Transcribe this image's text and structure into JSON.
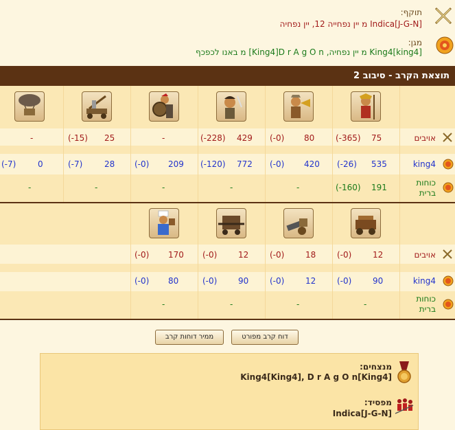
{
  "attacker": {
    "label": "תוקף:",
    "text": "Indica[J-G-N] מ יין נפחייה 12, יין נפחיה"
  },
  "defender": {
    "label": "מגן:",
    "text": "King4[king4] מ יין נפחיה, King4]D r A g O n] מ באנו לכפכף"
  },
  "battle_title": "תוצאת הקרב - סיבוב 2",
  "row_labels": {
    "enemies": "אויבים",
    "king4": "king4",
    "allies_line1": "כוחות",
    "allies_line2": "ברית"
  },
  "units_top": [
    {
      "icon": "spearman-unit-icon"
    },
    {
      "icon": "horn-unit-icon"
    },
    {
      "icon": "swordsman-unit-icon"
    },
    {
      "icon": "shield-unit-icon"
    },
    {
      "icon": "catapult-unit-icon"
    },
    {
      "icon": "airship-unit-icon"
    }
  ],
  "units_bottom": [
    {
      "icon": "cart-unit-icon"
    },
    {
      "icon": "cannon-unit-icon"
    },
    {
      "icon": "ram-unit-icon"
    },
    {
      "icon": "cook-unit-icon"
    }
  ],
  "top_enemies": [
    {
      "count": "75",
      "loss": "(-365)"
    },
    {
      "count": "80",
      "loss": "(-0)"
    },
    {
      "count": "429",
      "loss": "(-228)"
    },
    {
      "count": "",
      "loss": "-"
    },
    {
      "count": "25",
      "loss": "(-15)"
    },
    {
      "count": "",
      "loss": "-"
    }
  ],
  "top_king4": [
    {
      "count": "535",
      "loss": "(-26)"
    },
    {
      "count": "420",
      "loss": "(-0)"
    },
    {
      "count": "772",
      "loss": "(-120)"
    },
    {
      "count": "209",
      "loss": "(-0)"
    },
    {
      "count": "28",
      "loss": "(-7)"
    },
    {
      "count": "0",
      "loss": "(-7)"
    }
  ],
  "top_allies": [
    {
      "count": "191",
      "loss": "(-160)"
    },
    {
      "count": "",
      "loss": "-"
    },
    {
      "count": "",
      "loss": "-"
    },
    {
      "count": "",
      "loss": "-"
    },
    {
      "count": "",
      "loss": "-"
    },
    {
      "count": "",
      "loss": "-"
    }
  ],
  "bottom_enemies": [
    {
      "count": "12",
      "loss": "(-0)"
    },
    {
      "count": "18",
      "loss": "(-0)"
    },
    {
      "count": "12",
      "loss": "(-0)"
    },
    {
      "count": "170",
      "loss": "(-0)"
    }
  ],
  "bottom_king4": [
    {
      "count": "90",
      "loss": "(-0)"
    },
    {
      "count": "12",
      "loss": "(-0)"
    },
    {
      "count": "90",
      "loss": "(-0)"
    },
    {
      "count": "80",
      "loss": "(-0)"
    }
  ],
  "bottom_allies": [
    {
      "count": "",
      "loss": "-"
    },
    {
      "count": "",
      "loss": "-"
    },
    {
      "count": "",
      "loss": "-"
    },
    {
      "count": "",
      "loss": "-"
    }
  ],
  "buttons": {
    "detailed": "דוח קרב מפורט",
    "converter": "ממיר דוחות קרב"
  },
  "summary": {
    "winners_label": "מנצחים:",
    "winners_text": "King4[King4], D r A g O n[King4]",
    "losers_label": "מפסיד:",
    "losers_text": "Indica[J-G-N]"
  },
  "colors": {
    "header_bar": "#5b3213",
    "attacker_text": "#a11a1a",
    "defender_text": "#1a7a1a",
    "king4_text": "#2233cc"
  }
}
